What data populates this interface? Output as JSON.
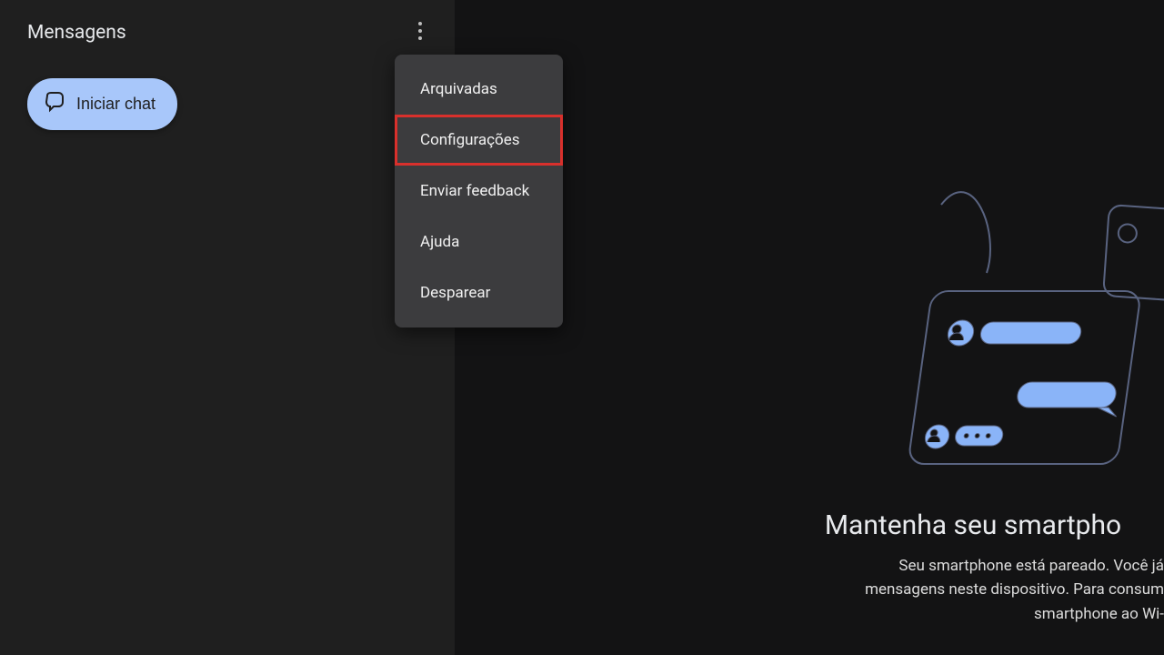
{
  "sidebar": {
    "brand": "Mensagens",
    "start_chat_label": "Iniciar chat"
  },
  "menu": {
    "items": [
      "Arquivadas",
      "Configurações",
      "Enviar feedback",
      "Ajuda",
      "Desparear"
    ],
    "highlighted_index": 1
  },
  "main": {
    "headline": "Mantenha seu smartpho",
    "body_line1": "Seu smartphone está pareado. Você já",
    "body_line2": "mensagens neste dispositivo. Para consum",
    "body_line3": "smartphone ao Wi-"
  },
  "colors": {
    "accent": "#a8c7fa",
    "highlight_border": "#d9302c"
  }
}
